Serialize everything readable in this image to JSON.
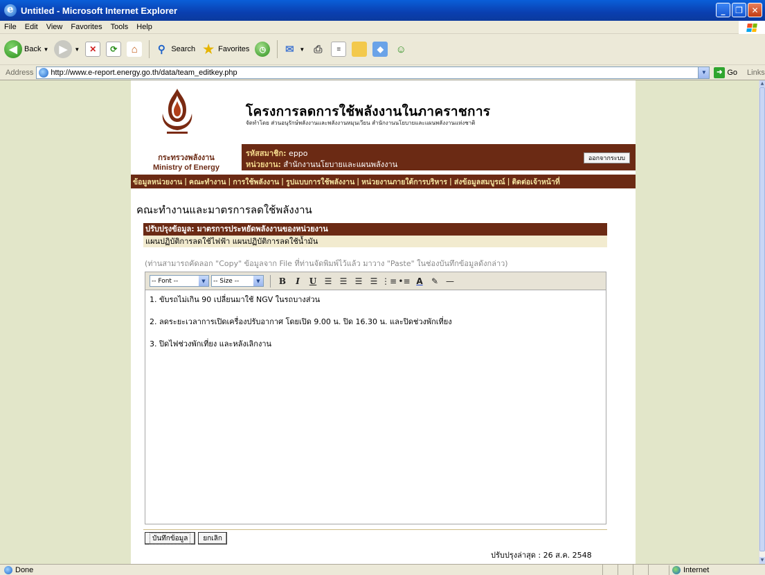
{
  "window": {
    "title": "Untitled - Microsoft Internet Explorer"
  },
  "menu": [
    "File",
    "Edit",
    "View",
    "Favorites",
    "Tools",
    "Help"
  ],
  "toolbar": {
    "back": "Back",
    "search": "Search",
    "favorites": "Favorites"
  },
  "address": {
    "label": "Address",
    "url": "http://www.e-report.energy.go.th/data/team_editkey.php",
    "go": "Go",
    "links": "Links"
  },
  "header": {
    "title": "โครงการลดการใช้พลังงานในภาคราชการ",
    "subtitle": "จัดทำโดย ส่วนอนุรักษ์พลังงานและพลังงานหมุนเวียน สำนักงานนโยบายและแผนพลังงานแห่งชาติ",
    "org_th": "กระทรวงพลังงาน",
    "org_en": "Ministry of Energy"
  },
  "user": {
    "member_label": "รหัสสมาชิก:",
    "member_value": "eppo",
    "unit_label": "หน่วยงาน:",
    "unit_value": "สำนักงานนโยบายและแผนพลังงาน",
    "logout": "ออกจากระบบ"
  },
  "nav": [
    "ข้อมูลหน่วยงาน",
    "คณะทำงาน",
    "การใช้พลังงาน",
    "รูปแบบการใช้พลังงาน",
    "หน่วยงานภายใต้การบริหาร",
    "ส่งข้อมูลสมบูรณ์",
    "ติดต่อเจ้าหน้าที่"
  ],
  "page": {
    "title": "คณะทำงานและมาตรการลดใช้พลังงาน",
    "section_header": "ปรับปรุงข้อมูล: มาตรการประหยัดพลังงานของหน่วยงาน",
    "section_sub": "แผนปฏิบัติการลดใช้ไฟฟ้า แผนปฏิบัติการลดใช้น้ำมัน",
    "hint": "(ท่านสามารถคัดลอก \"Copy\" ข้อมูลจาก File ที่ท่านจัดพิมพ์ไว้แล้ว มาวาง \"Paste\" ในช่องบันทึกข้อมูลดังกล่าว)",
    "font_select": "-- Font --",
    "size_select": "-- Size --",
    "editor_lines": [
      "1. ขับรถไม่เกิน 90 เปลี่ยนมาใช้ NGV ในรถบางส่วน",
      "2. ลดระยะเวลาการเปิดเครื่องปรับอากาศ โดยเปิด 9.00 น. ปิด 16.30 น. และปิดช่วงพักเที่ยง",
      "3. ปิดไฟช่วงพักเที่ยง และหลังเลิกงาน"
    ],
    "save_button": "บันทึกข้อมูล",
    "cancel_button": "ยกเลิก",
    "updated": "ปรับปรุงล่าสุด : 26 ส.ค. 2548"
  },
  "status": {
    "text": "Done",
    "zone": "Internet"
  }
}
